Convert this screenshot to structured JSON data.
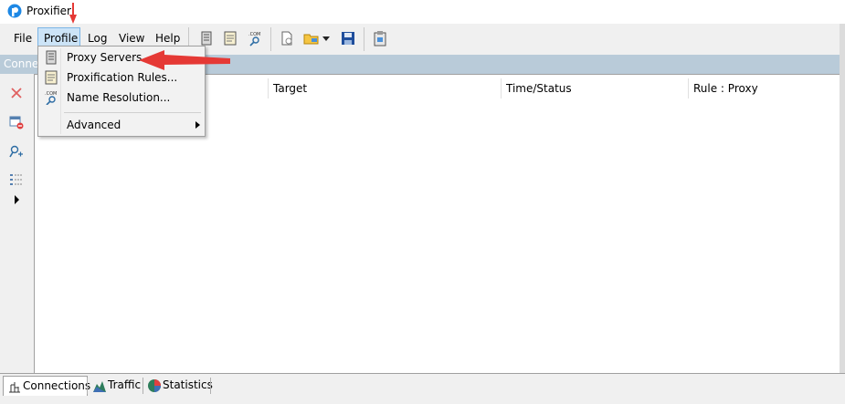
{
  "window": {
    "title": "Proxifier"
  },
  "menubar": {
    "items": [
      {
        "label": "File"
      },
      {
        "label": "Profile"
      },
      {
        "label": "Log"
      },
      {
        "label": "View"
      },
      {
        "label": "Help"
      }
    ]
  },
  "toolbar": {
    "icons": [
      "proxy-servers-icon",
      "proxification-rules-icon",
      "name-resolution-icon",
      "new-profile-icon",
      "open-profile-icon",
      "save-profile-icon",
      "clipboard-icon"
    ]
  },
  "connections_strip": {
    "label": "Conne"
  },
  "table": {
    "columns": [
      "Target",
      "Time/Status",
      "Rule : Proxy"
    ]
  },
  "profile_menu": {
    "items": [
      {
        "label": "Proxy Servers...",
        "icon": "server-icon"
      },
      {
        "label": "Proxification Rules...",
        "icon": "rules-icon"
      },
      {
        "label": "Name Resolution...",
        "icon": "dns-icon"
      },
      {
        "label": "Advanced",
        "icon": "submenu-arrow"
      }
    ]
  },
  "dns_label": ".COM",
  "tabs": [
    {
      "label": "Connections"
    },
    {
      "label": "Traffic"
    },
    {
      "label": "Statistics"
    }
  ],
  "colors": {
    "accent_arrow": "#e53935",
    "strip": "#b9cbd9",
    "menu_highlight": "#cce4f7"
  }
}
